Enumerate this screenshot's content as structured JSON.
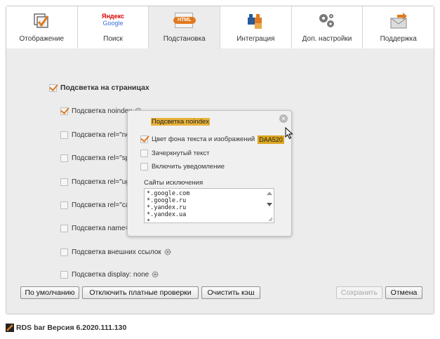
{
  "tabs": [
    {
      "label": "Отображение",
      "icon": "display-checkbox-icon"
    },
    {
      "label": "Поиск",
      "icon": "yandex-google-logo-icon",
      "logo_top": "Яндекс",
      "logo_bottom": "Google"
    },
    {
      "label": "Подстановка",
      "icon": "html-tag-icon",
      "badge": "HTML",
      "active": true
    },
    {
      "label": "Интеграция",
      "icon": "puzzle-blocks-icon"
    },
    {
      "label": "Доп. настройки",
      "icon": "gears-icon"
    },
    {
      "label": "Поддержка",
      "icon": "envelope-icon"
    }
  ],
  "main_option": {
    "label": "Подсветка на страницах",
    "checked": true
  },
  "options": [
    {
      "label": "Подсветка noindex",
      "checked": true,
      "gear": true
    },
    {
      "label": "Подсветка rel=\"nof",
      "checked": false
    },
    {
      "label": "Подсветка rel=\"spo",
      "checked": false
    },
    {
      "label": "Подсветка rel=\"ugc",
      "checked": false
    },
    {
      "label": "Подсветка rel=\"can",
      "checked": false
    },
    {
      "label": "Подсветка name=\"r",
      "checked": false
    },
    {
      "label": "Подсветка внешних ссылок",
      "checked": false,
      "gear": true
    },
    {
      "label": "Подсветка display: none",
      "checked": false,
      "gear": true
    }
  ],
  "popup": {
    "title": "Подсветка noindex",
    "options": [
      {
        "label": "Цвет фона текста и изображений",
        "checked": true,
        "color_value": "DAA520"
      },
      {
        "label": "Зачеркнутый текст",
        "checked": false
      },
      {
        "label": "Включить уведомление",
        "checked": false
      }
    ],
    "exceptions_label": "Сайты исключения",
    "exceptions": [
      "*.google.com",
      "*.google.ru",
      "*.yandex.ru",
      "*.yandex.ua",
      "*."
    ]
  },
  "buttons": {
    "defaults": "По умолчанию",
    "disable_paid": "Отключить платные проверки",
    "clear_cache": "Очистить кэш",
    "save": "Сохранить",
    "cancel": "Отмена"
  },
  "footer": {
    "text": "RDS bar Версия 6.2020.111.130"
  },
  "colors": {
    "accent": "#e07a1f",
    "highlight": "#daa520",
    "background": "#ececec"
  }
}
